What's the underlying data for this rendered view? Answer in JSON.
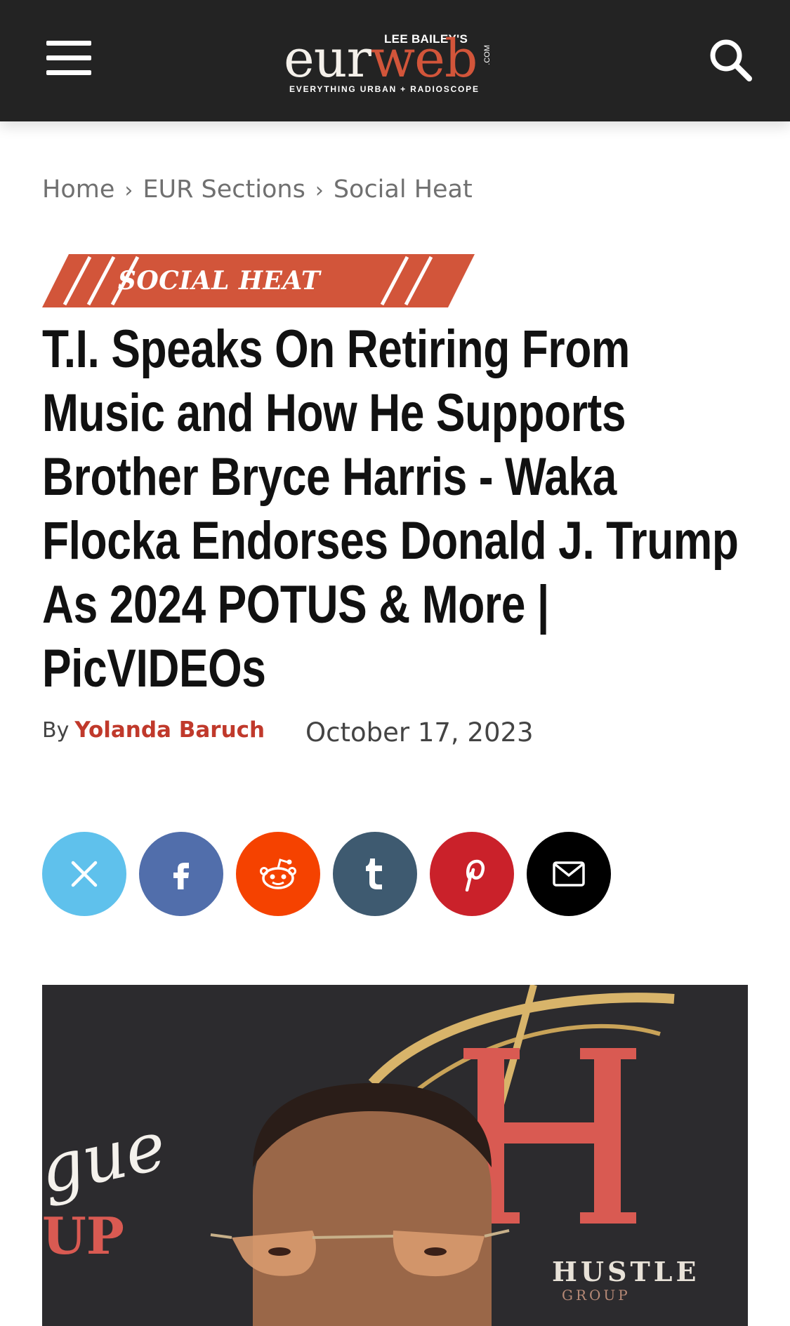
{
  "header": {
    "menu_icon": "hamburger-icon",
    "search_icon": "search-icon",
    "logo": {
      "small_text": "LEE BAILEY'S",
      "part1": "eur",
      "part2": "web",
      "com": ".COM",
      "tagline": "EVERYTHING URBAN + RADIOSCOPE"
    }
  },
  "breadcrumb": [
    "Home",
    "EUR Sections",
    "Social Heat"
  ],
  "category": "SOCIAL HEAT",
  "article": {
    "title": "T.I. Speaks On Retiring From Music and How He Supports Brother Bryce Harris - Waka Flocka Endorses Donald J. Trump As 2024 POTUS & More | PicVIDEOs",
    "by_label": "By",
    "author": "Yolanda Baruch",
    "date": "October 17, 2023"
  },
  "share": [
    {
      "network": "x",
      "icon": "x-icon",
      "color": "#5fc1ec"
    },
    {
      "network": "facebook",
      "icon": "facebook-icon",
      "color": "#516eab"
    },
    {
      "network": "reddit",
      "icon": "reddit-icon",
      "color": "#f54200"
    },
    {
      "network": "tumblr",
      "icon": "tumblr-icon",
      "color": "#3e5a70"
    },
    {
      "network": "pinterest",
      "icon": "pinterest-icon",
      "color": "#ca212a"
    },
    {
      "network": "email",
      "icon": "envelope-icon",
      "color": "#000000"
    }
  ],
  "hero_backdrop_text": {
    "left": "gue",
    "left2": "UP",
    "right": "HUSTLE",
    "right2": "GROUP"
  },
  "colors": {
    "header_bg": "#232323",
    "accent": "#d2553a",
    "author": "#c0392b"
  }
}
